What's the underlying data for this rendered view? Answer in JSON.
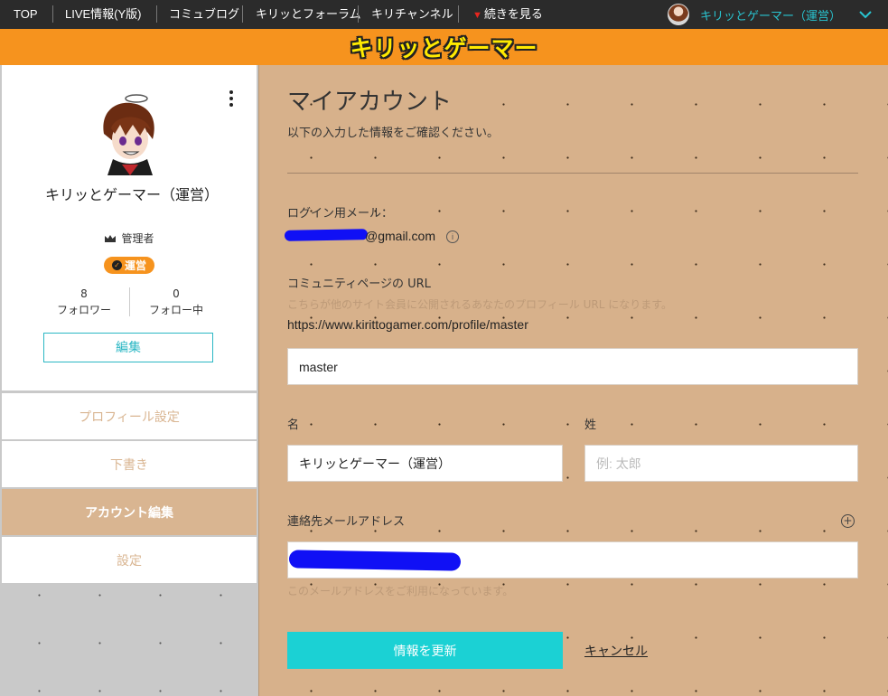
{
  "nav": {
    "items": [
      "TOP",
      "LIVE情報(Y版)",
      "コミュブログ",
      "キリッとフォーラム",
      "キリチャンネル",
      "続きを見る"
    ],
    "user_name": "キリッとゲーマー（運営）"
  },
  "banner": {
    "logo_text": "キリッとゲーマー"
  },
  "profile": {
    "name": "キリッとゲーマー（運営）",
    "role": "管理者",
    "badge": "運営",
    "followers_count": "8",
    "followers_label": "フォロワー",
    "following_count": "0",
    "following_label": "フォロー中",
    "edit_label": "編集"
  },
  "menu": {
    "items": [
      "プロフィール設定",
      "下書き",
      "アカウント編集",
      "設定"
    ],
    "active_index": 2
  },
  "account": {
    "title": "マイアカウント",
    "subtitle": "以下の入力した情報をご確認ください。",
    "login_email_label": "ログイン用メール：",
    "login_email_suffix": "@gmail.com",
    "url_label": "コミュニティページの URL",
    "url_hint": "こちらが他のサイト会員に公開されるあなたのプロフィール URL になります。",
    "url_value": "https://www.kirittogamer.com/profile/master",
    "slug_value": "master",
    "first_name_label": "名",
    "last_name_label": "姓",
    "first_name_value": "キリッとゲーマー（運営）",
    "last_name_placeholder": "例: 太郎",
    "contact_email_label": "連絡先メールアドレス",
    "contact_email_hint": "このメールアドレスをご利用になっています。",
    "submit_label": "情報を更新",
    "cancel_label": "キャンセル"
  },
  "colors": {
    "accent_orange": "#f6931e",
    "teal": "#1bd1d4",
    "tan": "#d7b18b",
    "redaction": "#1010f5"
  }
}
